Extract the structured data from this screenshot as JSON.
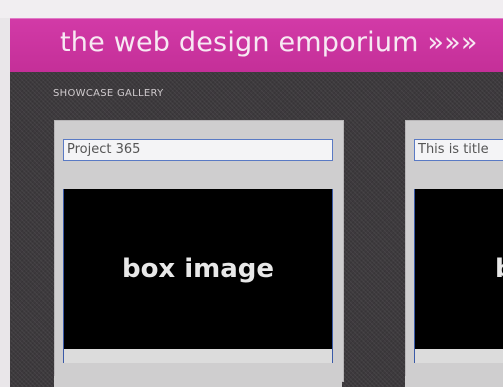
{
  "header": {
    "title": "the web design emporium »»»"
  },
  "gallery": {
    "section_label": "SHOWCASE GALLERY",
    "cards": [
      {
        "title": "Project 365",
        "image_label": "box image"
      },
      {
        "title": "This is title",
        "image_label": "box image"
      }
    ]
  },
  "colors": {
    "header_magenta": "#c42f98",
    "panel_dark": "#3d3a3d",
    "image_box": "#000000"
  }
}
